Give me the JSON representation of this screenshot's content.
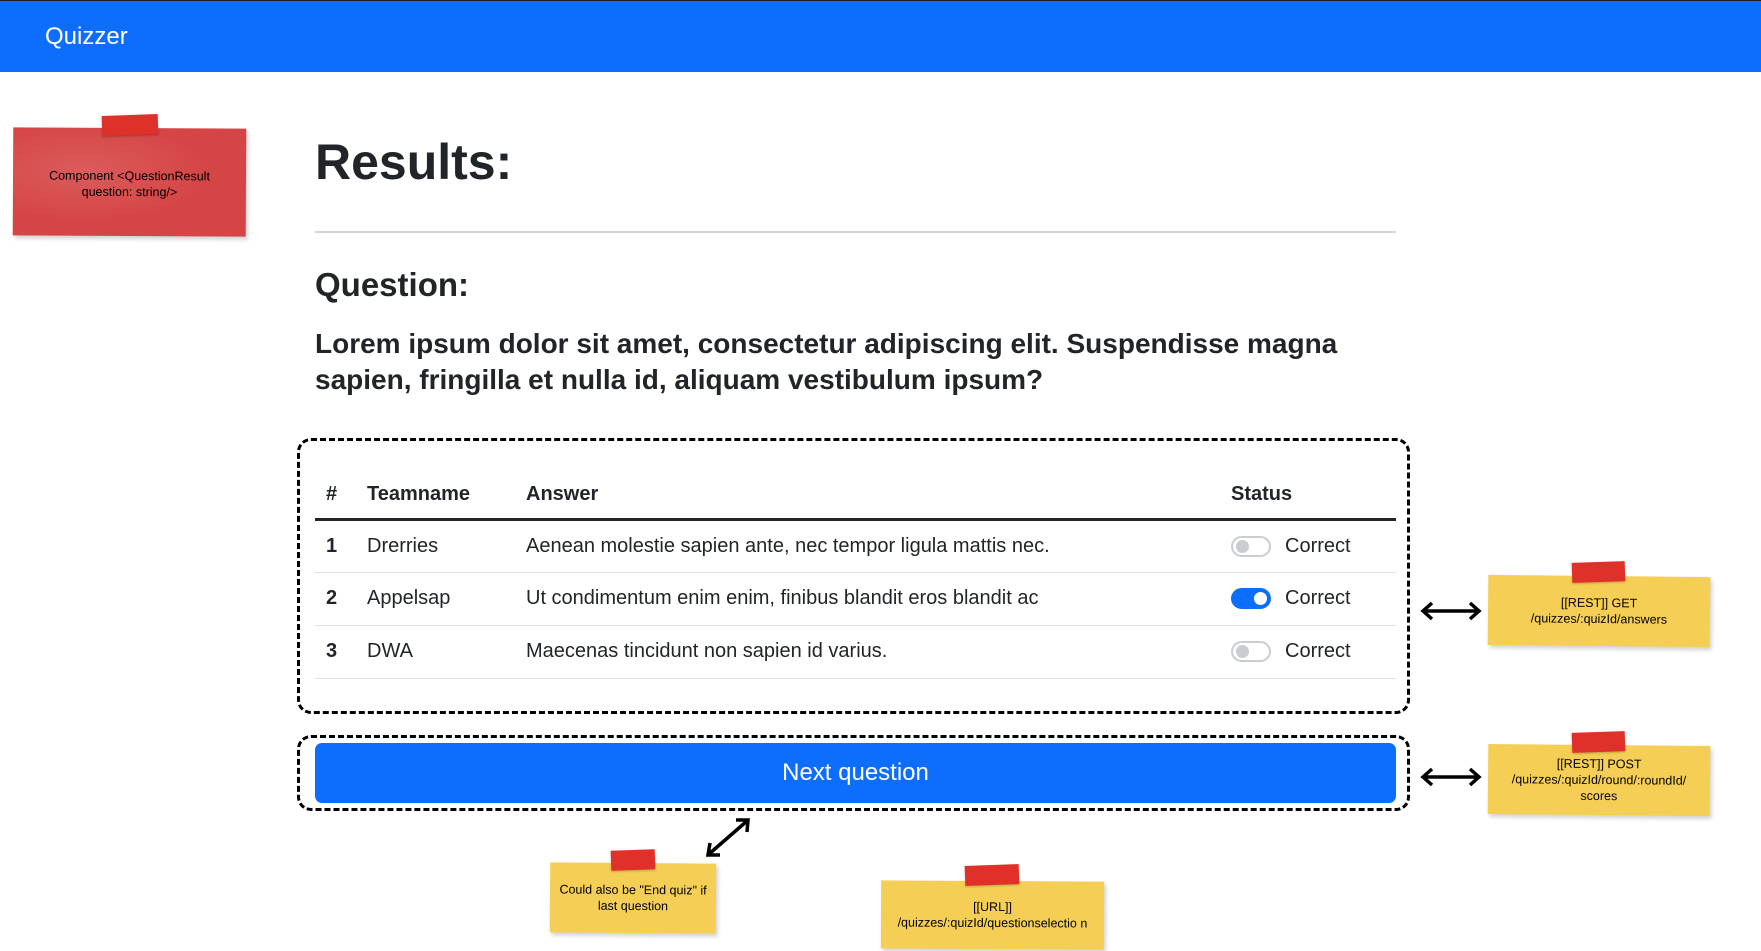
{
  "app": {
    "brand": "Quizzer"
  },
  "page": {
    "title": "Results:",
    "question_label": "Question:",
    "question_text": "Lorem ipsum dolor sit amet, consectetur adipiscing elit. Suspendisse magna sapien, fringilla et nulla id, aliquam vestibulum ipsum?"
  },
  "table": {
    "headers": {
      "num": "#",
      "team": "Teamname",
      "answer": "Answer",
      "status": "Status"
    },
    "rows": [
      {
        "num": "1",
        "team": "Drerries",
        "answer": "Aenean molestie sapien ante, nec tempor ligula mattis nec.",
        "status": "Correct",
        "checked": false
      },
      {
        "num": "2",
        "team": "Appelsap",
        "answer": "Ut condimentum enim enim, finibus blandit eros blandit ac",
        "status": "Correct",
        "checked": true
      },
      {
        "num": "3",
        "team": "DWA",
        "answer": "Maecenas tincidunt non sapien id varius.",
        "status": "Correct",
        "checked": false
      }
    ]
  },
  "next_button": {
    "label": "Next question"
  },
  "notes": {
    "component": "Component <QuestionResult question: string/>",
    "rest_get": "[[REST]] GET /quizzes/:quizId/answers",
    "rest_post": "[[REST]] POST /quizzes/:quizId/round/:roundId/ scores",
    "end_quiz": "Could also be \"End quiz\" if last question",
    "url": "[[URL]] /quizzes/:quizId/questionselectio n"
  },
  "colors": {
    "primary": "#0d6efd",
    "sticky_yellow": "#f5cf55",
    "sticky_red": "#d64545",
    "tape": "#e0302a"
  }
}
